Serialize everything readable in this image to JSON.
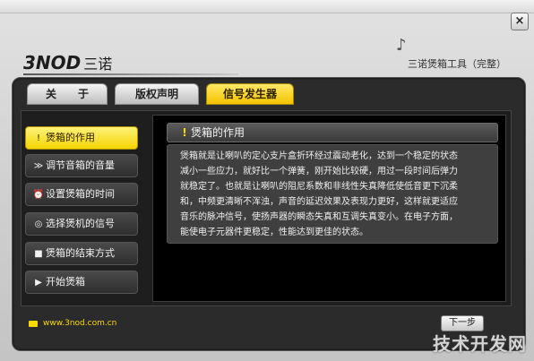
{
  "window": {
    "close_glyph": "×"
  },
  "brand": {
    "logo_text": "3NOD",
    "logo_cn": "三诺",
    "app_title": "三诺煲箱工具（完整）",
    "notes_glyph": "♪"
  },
  "tabs": [
    {
      "label": "关　　于",
      "active": false
    },
    {
      "label": "版权声明",
      "active": false
    },
    {
      "label": "信号发生器",
      "active": true
    }
  ],
  "sidebar": [
    {
      "label": "煲箱的作用",
      "icon": "warning-icon",
      "glyph": "!",
      "active": true
    },
    {
      "label": "调节音箱的音量",
      "icon": "speaker-icon",
      "glyph": "≫",
      "active": false
    },
    {
      "label": "设置煲箱的时间",
      "icon": "alarm-clock-icon",
      "glyph": "⏰",
      "active": false
    },
    {
      "label": "选择煲机的信号",
      "icon": "signal-icon",
      "glyph": "◎",
      "active": false
    },
    {
      "label": "煲箱的结束方式",
      "icon": "stop-icon",
      "glyph": "■",
      "active": false
    },
    {
      "label": "开始煲箱",
      "icon": "play-icon",
      "glyph": "▶",
      "active": false
    }
  ],
  "section": {
    "title": "煲箱的作用",
    "warn_glyph": "!",
    "lines": [
      "煲箱就是让喇叭的定心支片盒折环经过震动老化，达到一个稳定的状态",
      "减小一些应力，就好比一个弹簧，刚开始比较硬，用过一段时间后弹力",
      "就稳定了。也就是让喇叭的阻尼系数和非线性失真降低使低音更下沉柔",
      "和，中频更清晰不浑浊，声音的延迟效果及表现力更好，这样就更适应",
      "音乐的脉冲信号，使扬声器的瞬态失真和互调失真变小。在电子方面，",
      "能使电子元器件更稳定，性能达到更佳的状态。"
    ]
  },
  "footer": {
    "url": "www.3nod.com.cn",
    "next_label": "下一步"
  },
  "watermark": "技术开发网"
}
